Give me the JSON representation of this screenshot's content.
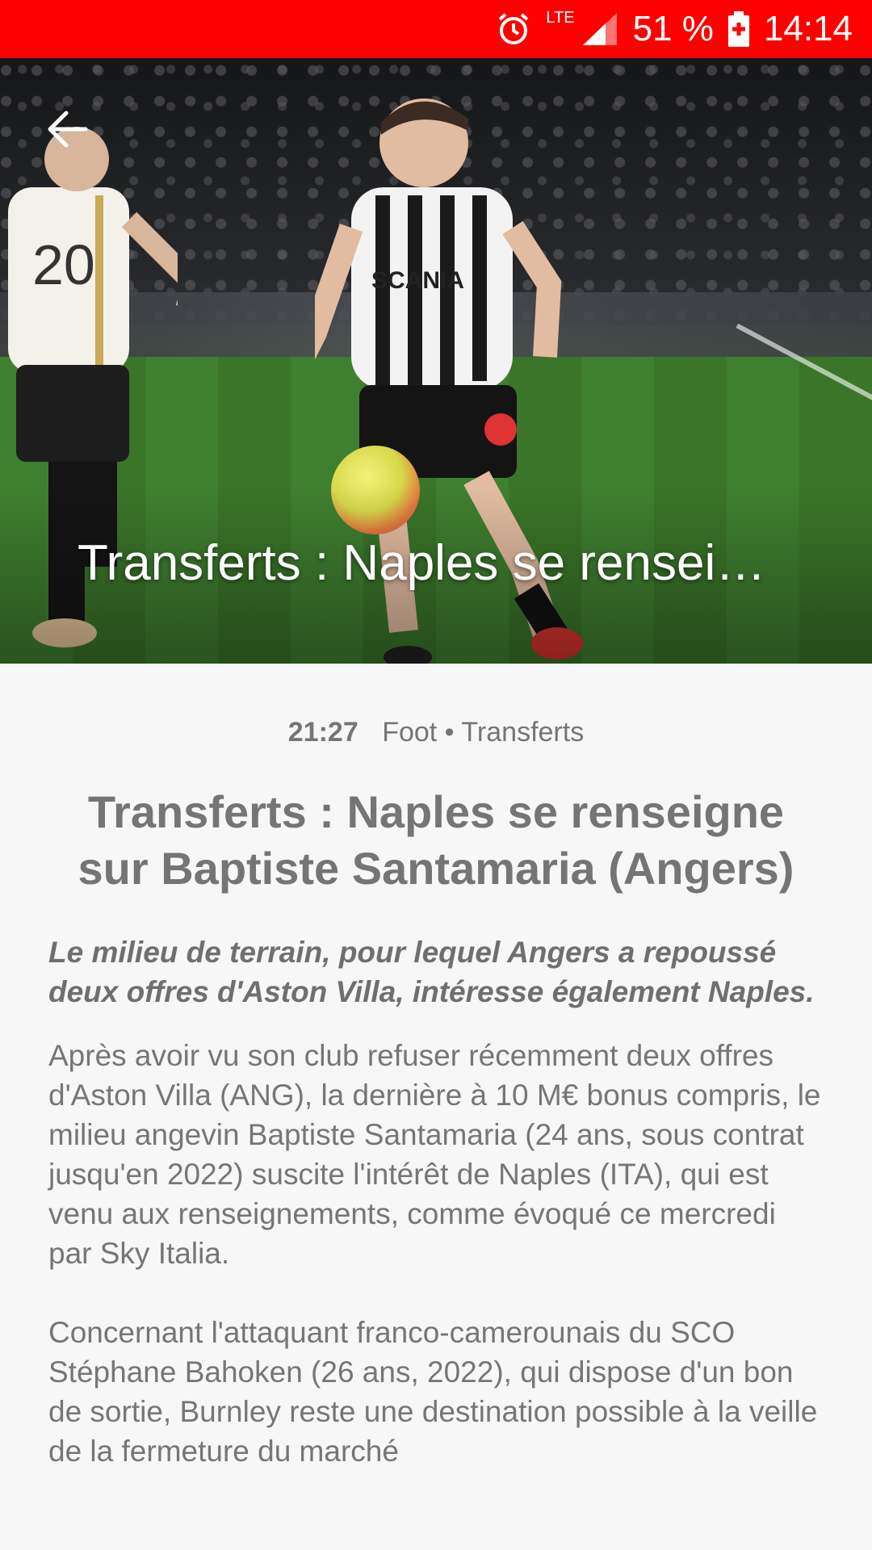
{
  "status_bar": {
    "battery_percent": "51 %",
    "time": "14:14",
    "network": "LTE",
    "icons": [
      "alarm-icon",
      "signal-icon",
      "battery-icon"
    ],
    "bg_color": "#ff0000"
  },
  "hero": {
    "title": "Transferts : Naples se rensei…",
    "back_icon": "arrow-left-icon"
  },
  "article": {
    "time": "21:27",
    "category": "Foot • Transferts",
    "headline": "Transferts : Naples se renseigne sur Baptiste Santamaria (Angers)",
    "lede": "Le milieu de terrain, pour lequel Angers a repoussé deux offres d'Aston Villa, intéresse également Naples.",
    "paragraphs": [
      "Après avoir vu son club refuser récemment deux offres d'Aston Villa (ANG), la dernière à 10 M€ bonus compris, le milieu angevin Baptiste Santamaria (24 ans, sous contrat jusqu'en 2022) suscite l'intérêt de Naples (ITA), qui est venu aux renseignements, comme évoqué ce mercredi par Sky Italia.",
      "Concernant l'attaquant franco-camerounais du SCO Stéphane Bahoken (26 ans, 2022), qui dispose d'un bon de sortie, Burnley reste une destination possible à la veille de la fermeture du marché"
    ]
  }
}
